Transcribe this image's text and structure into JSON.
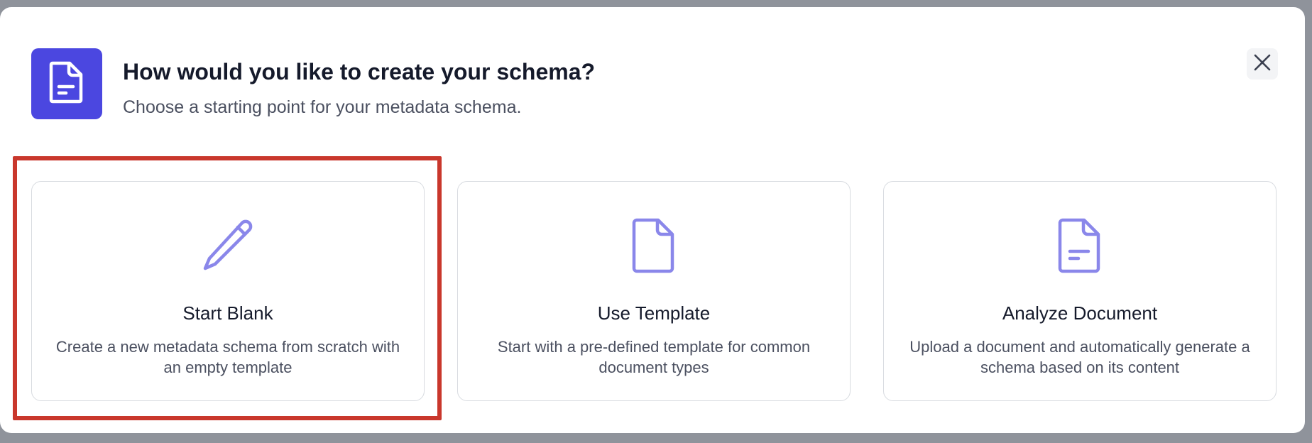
{
  "dialog": {
    "title": "How would you like to create your schema?",
    "subtitle": "Choose a starting point for your metadata schema.",
    "header_icon": "document-icon",
    "close_icon": "close-icon"
  },
  "options": [
    {
      "icon": "pencil-icon",
      "title": "Start Blank",
      "description": "Create a new metadata schema from scratch with an empty template"
    },
    {
      "icon": "file-icon",
      "title": "Use Template",
      "description": "Start with a pre-defined template for common document types"
    },
    {
      "icon": "document-text-icon",
      "title": "Analyze Document",
      "description": "Upload a document and automatically generate a schema based on its content"
    }
  ],
  "colors": {
    "accent": "#4b47e0",
    "icon_light": "#8a87ea",
    "highlight": "#c9372c",
    "backdrop": "#8f939b"
  }
}
